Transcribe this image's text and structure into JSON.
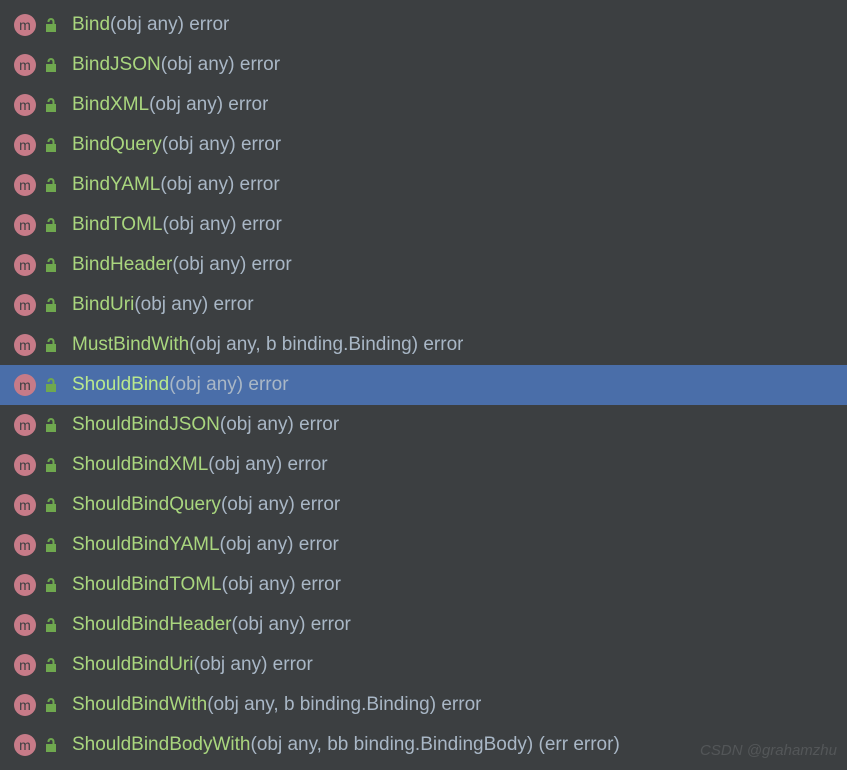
{
  "selectedIndex": 9,
  "watermark": "CSDN @grahamzhu",
  "methodIcon": "m",
  "items": [
    {
      "name": "Bind",
      "params": "(obj any)",
      "returns": " error"
    },
    {
      "name": "BindJSON",
      "params": "(obj any)",
      "returns": " error"
    },
    {
      "name": "BindXML",
      "params": "(obj any)",
      "returns": " error"
    },
    {
      "name": "BindQuery",
      "params": "(obj any)",
      "returns": " error"
    },
    {
      "name": "BindYAML",
      "params": "(obj any)",
      "returns": " error"
    },
    {
      "name": "BindTOML",
      "params": "(obj any)",
      "returns": " error"
    },
    {
      "name": "BindHeader",
      "params": "(obj any)",
      "returns": " error"
    },
    {
      "name": "BindUri",
      "params": "(obj any)",
      "returns": " error"
    },
    {
      "name": "MustBindWith",
      "params": "(obj any, b binding.Binding)",
      "returns": " error"
    },
    {
      "name": "ShouldBind",
      "params": "(obj any)",
      "returns": " error"
    },
    {
      "name": "ShouldBindJSON",
      "params": "(obj any)",
      "returns": " error"
    },
    {
      "name": "ShouldBindXML",
      "params": "(obj any)",
      "returns": " error"
    },
    {
      "name": "ShouldBindQuery",
      "params": "(obj any)",
      "returns": " error"
    },
    {
      "name": "ShouldBindYAML",
      "params": "(obj any)",
      "returns": " error"
    },
    {
      "name": "ShouldBindTOML",
      "params": "(obj any)",
      "returns": " error"
    },
    {
      "name": "ShouldBindHeader",
      "params": "(obj any)",
      "returns": " error"
    },
    {
      "name": "ShouldBindUri",
      "params": "(obj any)",
      "returns": " error"
    },
    {
      "name": "ShouldBindWith",
      "params": "(obj any, b binding.Binding)",
      "returns": " error"
    },
    {
      "name": "ShouldBindBodyWith",
      "params": "(obj any, bb binding.BindingBody)",
      "returns": " (err error)"
    }
  ]
}
